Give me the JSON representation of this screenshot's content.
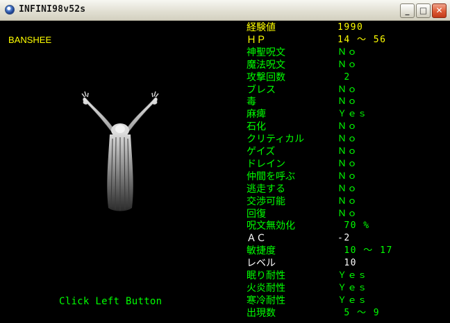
{
  "window": {
    "title": "INFINI98v52s",
    "buttons": {
      "minimize": "_",
      "maximize": "□",
      "close": "✕"
    }
  },
  "monster": {
    "name": "BANSHEE"
  },
  "prompt": "Click Left Button",
  "colors": {
    "green": "#00ff00",
    "white": "#ffffff",
    "yellow": "#ffff00",
    "background": "#000000"
  },
  "stats": [
    {
      "label": "経験値",
      "value": "1990",
      "color": "yellow"
    },
    {
      "label": "ＨＰ",
      "value": "14 ～ 56",
      "color": "yellow"
    },
    {
      "label": "神聖呪文",
      "value": "Ｎｏ",
      "color": "green"
    },
    {
      "label": "魔法呪文",
      "value": "Ｎｏ",
      "color": "green"
    },
    {
      "label": "攻撃回数",
      "value": " 2",
      "color": "green"
    },
    {
      "label": "ブレス",
      "value": "Ｎｏ",
      "color": "green"
    },
    {
      "label": "毒",
      "value": "Ｎｏ",
      "color": "green"
    },
    {
      "label": "麻痺",
      "value": "Ｙｅｓ",
      "color": "green"
    },
    {
      "label": "石化",
      "value": "Ｎｏ",
      "color": "green"
    },
    {
      "label": "クリティカル",
      "value": "Ｎｏ",
      "color": "green"
    },
    {
      "label": "ゲイズ",
      "value": "Ｎｏ",
      "color": "green"
    },
    {
      "label": "ドレイン",
      "value": "Ｎｏ",
      "color": "green"
    },
    {
      "label": "仲間を呼ぶ",
      "value": "Ｎｏ",
      "color": "green"
    },
    {
      "label": "逃走する",
      "value": "Ｎｏ",
      "color": "green"
    },
    {
      "label": "交渉可能",
      "value": "Ｎｏ",
      "color": "green"
    },
    {
      "label": "回復",
      "value": "Ｎｏ",
      "color": "green"
    },
    {
      "label": "呪文無効化",
      "value": " 70 %",
      "color": "green"
    },
    {
      "label": "ＡＣ",
      "value": "-2",
      "color": "white"
    },
    {
      "label": "敏捷度",
      "value": " 10 ～ 17",
      "color": "green"
    },
    {
      "label": "レベル",
      "value": " 10",
      "color": "white"
    },
    {
      "label": "眠り耐性",
      "value": "Ｙｅｓ",
      "color": "green"
    },
    {
      "label": "火炎耐性",
      "value": "Ｙｅｓ",
      "color": "green"
    },
    {
      "label": "寒冷耐性",
      "value": "Ｙｅｓ",
      "color": "green"
    },
    {
      "label": "出現数",
      "value": " 5 ～ 9",
      "color": "green"
    }
  ]
}
